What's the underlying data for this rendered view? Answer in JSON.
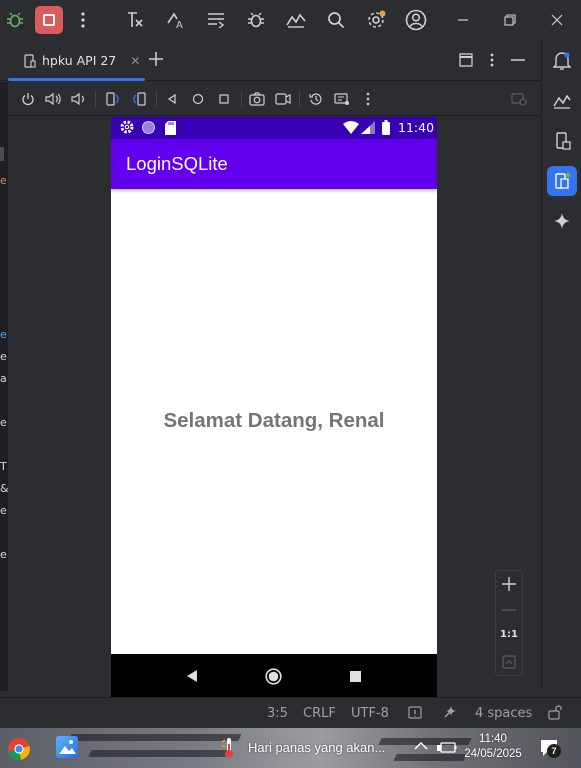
{
  "ide": {
    "tool_window": {
      "device_tab_label": "hpku API 27"
    },
    "status_bar": {
      "cursor_position": "3:5",
      "line_separator": "CRLF",
      "encoding": "UTF-8",
      "indent": "4 spaces"
    },
    "zoom": {
      "actual_size_label": "1:1"
    },
    "accent_color": "#3574f0"
  },
  "emulator": {
    "status_bar": {
      "time": "11:40"
    },
    "app": {
      "title": "LoginSQLite",
      "welcome_text": "Selamat Datang, Renal",
      "primary_color": "#6200ee",
      "primary_dark_color": "#3700b3"
    }
  },
  "taskbar": {
    "weather_text": "Hari panas yang akan...",
    "clock_time": "11:40",
    "clock_date": "24/05/2025",
    "notification_count": "7"
  }
}
